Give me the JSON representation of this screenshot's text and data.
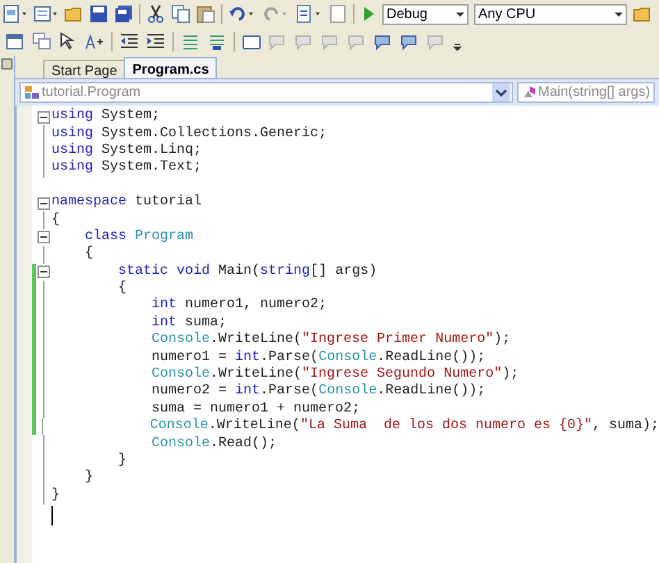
{
  "toolbar": {
    "configuration": "Debug",
    "platform": "Any CPU"
  },
  "tabs": [
    {
      "label": "Start Page",
      "selected": false
    },
    {
      "label": "Program.cs",
      "selected": true
    }
  ],
  "navigation": {
    "type_dropdown": "tutorial.Program",
    "member_dropdown": "Main(string[] args)"
  },
  "code_lines": [
    {
      "fold_box": true,
      "changed": false,
      "tokens": [
        {
          "text": "using",
          "kind": "keyword"
        },
        {
          "text": " System;",
          "kind": "plain"
        }
      ]
    },
    {
      "fold_box": false,
      "changed": false,
      "tokens": [
        {
          "text": "using",
          "kind": "keyword"
        },
        {
          "text": " System.Collections.Generic;",
          "kind": "plain"
        }
      ]
    },
    {
      "fold_box": false,
      "changed": false,
      "tokens": [
        {
          "text": "using",
          "kind": "keyword"
        },
        {
          "text": " System.Linq;",
          "kind": "plain"
        }
      ]
    },
    {
      "fold_box": false,
      "changed": false,
      "tokens": [
        {
          "text": "using",
          "kind": "keyword"
        },
        {
          "text": " System.Text;",
          "kind": "plain"
        }
      ]
    },
    {
      "fold_box": false,
      "changed": false
    },
    {
      "fold_box": true,
      "changed": false,
      "tokens": [
        {
          "text": "namespace",
          "kind": "keyword"
        },
        {
          "text": " tutorial",
          "kind": "plain"
        }
      ]
    },
    {
      "fold_box": false,
      "changed": false,
      "tokens": [
        {
          "text": "{",
          "kind": "plain"
        }
      ]
    },
    {
      "fold_box": true,
      "changed": false,
      "tokens": [
        {
          "text": "    class",
          "kind": "keyword"
        },
        {
          "text": " Program",
          "kind": "type"
        }
      ]
    },
    {
      "fold_box": false,
      "changed": false,
      "tokens": [
        {
          "text": "    {",
          "kind": "plain"
        }
      ]
    },
    {
      "fold_box": true,
      "changed": true,
      "tokens": [
        {
          "text": "        static void",
          "kind": "keyword"
        },
        {
          "text": " Main(",
          "kind": "plain"
        },
        {
          "text": "string",
          "kind": "keyword"
        },
        {
          "text": "[] args)",
          "kind": "plain"
        }
      ]
    },
    {
      "fold_box": false,
      "changed": true,
      "tokens": [
        {
          "text": "        {",
          "kind": "plain"
        }
      ]
    },
    {
      "fold_box": false,
      "changed": true,
      "tokens": [
        {
          "text": "            int",
          "kind": "keyword"
        },
        {
          "text": " numero1, numero2;",
          "kind": "plain"
        }
      ]
    },
    {
      "fold_box": false,
      "changed": true,
      "tokens": [
        {
          "text": "            int",
          "kind": "keyword"
        },
        {
          "text": " suma;",
          "kind": "plain"
        }
      ]
    },
    {
      "fold_box": false,
      "changed": true,
      "tokens": [
        {
          "text": "            Console",
          "kind": "type"
        },
        {
          "text": ".WriteLine(",
          "kind": "plain"
        },
        {
          "text": "\"Ingrese Primer Numero\"",
          "kind": "string"
        },
        {
          "text": ");",
          "kind": "plain"
        }
      ]
    },
    {
      "fold_box": false,
      "changed": true,
      "tokens": [
        {
          "text": "            numero1 = ",
          "kind": "plain"
        },
        {
          "text": "int",
          "kind": "keyword"
        },
        {
          "text": ".Parse(",
          "kind": "plain"
        },
        {
          "text": "Console",
          "kind": "type"
        },
        {
          "text": ".ReadLine());",
          "kind": "plain"
        }
      ]
    },
    {
      "fold_box": false,
      "changed": true,
      "tokens": [
        {
          "text": "            Console",
          "kind": "type"
        },
        {
          "text": ".WriteLine(",
          "kind": "plain"
        },
        {
          "text": "\"Ingrese Segundo Numero\"",
          "kind": "string"
        },
        {
          "text": ");",
          "kind": "plain"
        }
      ]
    },
    {
      "fold_box": false,
      "changed": true,
      "tokens": [
        {
          "text": "            numero2 = ",
          "kind": "plain"
        },
        {
          "text": "int",
          "kind": "keyword"
        },
        {
          "text": ".Parse(",
          "kind": "plain"
        },
        {
          "text": "Console",
          "kind": "type"
        },
        {
          "text": ".ReadLine());",
          "kind": "plain"
        }
      ]
    },
    {
      "fold_box": false,
      "changed": true,
      "tokens": [
        {
          "text": "            suma = numero1 + numero2;",
          "kind": "plain"
        }
      ]
    },
    {
      "fold_box": false,
      "changed": true,
      "tokens": [
        {
          "text": "            Console",
          "kind": "type"
        },
        {
          "text": ".WriteLine(",
          "kind": "plain"
        },
        {
          "text": "\"La Suma  de los dos numero es {0}\"",
          "kind": "string"
        },
        {
          "text": ", suma);",
          "kind": "plain"
        }
      ]
    },
    {
      "fold_box": false,
      "changed": false,
      "tokens": [
        {
          "text": "            Console",
          "kind": "type"
        },
        {
          "text": ".Read();",
          "kind": "plain"
        }
      ]
    },
    {
      "fold_box": false,
      "changed": false,
      "tokens": [
        {
          "text": "        }",
          "kind": "plain"
        }
      ]
    },
    {
      "fold_box": false,
      "changed": false,
      "tokens": [
        {
          "text": "    }",
          "kind": "plain"
        }
      ]
    },
    {
      "fold_box": false,
      "changed": false,
      "tokens": [
        {
          "text": "}",
          "kind": "plain"
        }
      ]
    }
  ]
}
